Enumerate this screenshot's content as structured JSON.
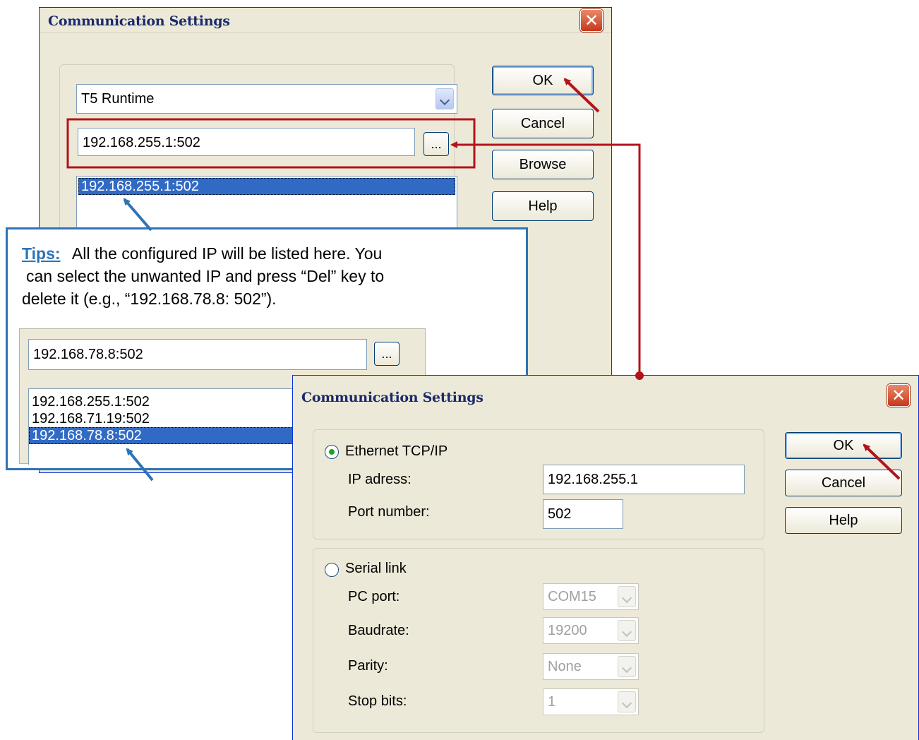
{
  "dialog1": {
    "title": "Communication Settings",
    "close_symbol": "✕",
    "driver_select": "T5 Runtime",
    "address_value": "192.168.255.1:502",
    "browse_dots": "...",
    "list_items": [
      "192.168.255.1:502"
    ],
    "buttons": {
      "ok": "OK",
      "cancel": "Cancel",
      "browse": "Browse",
      "help": "Help"
    }
  },
  "tips": {
    "label": "Tips:",
    "line1": "All the configured IP will be listed here. You",
    "line2": "can select the unwanted IP and press “Del” key to",
    "line3": "delete it (e.g., “192.168.78.8: 502”).",
    "example_address": "192.168.78.8:502",
    "example_dots": "...",
    "example_list": [
      "192.168.255.1:502",
      "192.168.71.19:502",
      "192.168.78.8:502"
    ]
  },
  "dialog2": {
    "title": "Communication Settings",
    "close_symbol": "✕",
    "ethernet_label": "Ethernet TCP/IP",
    "ip_label": "IP adress:",
    "ip_value": "192.168.255.1",
    "port_label": "Port number:",
    "port_value": "502",
    "serial_label": "Serial link",
    "pc_port_label": "PC port:",
    "pc_port_value": "COM15",
    "baudrate_label": "Baudrate:",
    "baudrate_value": "19200",
    "parity_label": "Parity:",
    "parity_value": "None",
    "stopbits_label": "Stop bits:",
    "stopbits_value": "1",
    "buttons": {
      "ok": "OK",
      "cancel": "Cancel",
      "help": "Help"
    }
  },
  "colors": {
    "highlight_box": "#b5121b",
    "tips_border": "#2e74b5",
    "dialog_bg": "#ece9d8",
    "selection": "#316ac5"
  }
}
